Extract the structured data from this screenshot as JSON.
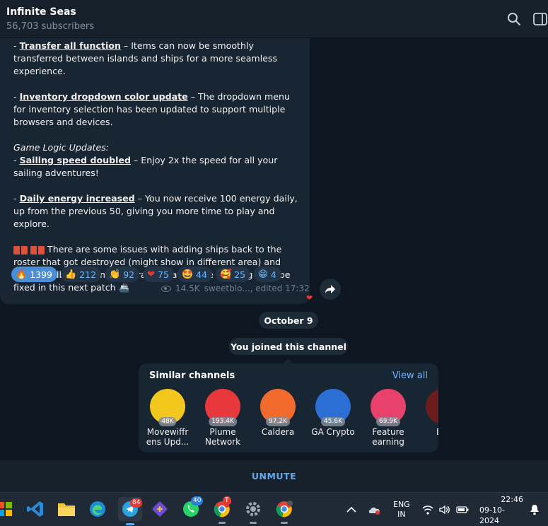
{
  "header": {
    "title": "Infinite Seas",
    "subscribers": "56,703 subscribers",
    "icons": [
      "search-icon",
      "sidebar-toggle-icon"
    ]
  },
  "message": {
    "line1_prefix": "- ",
    "line1_bold": "Transfer all function",
    "line1_rest": " – Items can now be smoothly transferred between islands and ships for a more seamless experience.",
    "line2_prefix": "- ",
    "line2_bold": "Inventory dropdown color update",
    "line2_rest": " – The dropdown menu for inventory selection has been updated to support multiple browsers and devices.",
    "section_title": "Game Logic Updates:",
    "line3_prefix": "- ",
    "line3_bold": "Sailing speed doubled",
    "line3_rest": " – Enjoy 2x the speed for all your sailing adventures!",
    "line4_prefix": "- ",
    "line4_bold": "Daily energy increased",
    "line4_rest": " – You now receive 100 energy daily, up from the previous 50, giving you more time to play and explore.",
    "line5": " There are some issues with adding ships back to the roster that got destroyed (might show in different area) and more feedbacks from our pirates that we are tracking - will be fixed in this next patch ",
    "ship_emoji": "🚢",
    "reactions": [
      {
        "emoji": "🔥",
        "count": "1399",
        "selected": true
      },
      {
        "emoji": "👍",
        "count": "212"
      },
      {
        "emoji": "👏",
        "count": "92"
      },
      {
        "emoji": "❤",
        "count": "75"
      },
      {
        "emoji": "🤩",
        "count": "44"
      },
      {
        "emoji": "🥰",
        "count": "25"
      },
      {
        "emoji": "😁",
        "count": "4"
      }
    ],
    "views": "14.5K",
    "author_edited": "sweetblo..., edited 17:32",
    "heart": "❤"
  },
  "date_pill": "October 9",
  "joined_pill": "You joined this channel",
  "similar": {
    "heading": "Similar channels",
    "view_all": "View all",
    "channels": [
      {
        "name1": "Movewiffr",
        "name2": "ens Upd...",
        "count": "48K",
        "color": "#f2c81f"
      },
      {
        "name1": "Plume",
        "name2": "Network",
        "count": "193.4K",
        "color": "#e8383e"
      },
      {
        "name1": "Caldera",
        "name2": "",
        "count": "97.2K",
        "color": "#f26a2e"
      },
      {
        "name1": "GA Crypto",
        "name2": "",
        "count": "45.6K",
        "color": "#2c6fd4"
      },
      {
        "name1": "Feature",
        "name2": "earning",
        "count": "69.9K",
        "color": "#e8416b"
      },
      {
        "name1": "Eth",
        "name2": "Cr",
        "count": "",
        "color": "#6b1d1d"
      }
    ]
  },
  "unmute": "UNMUTE",
  "taskbar": {
    "telegram_badge": "84",
    "whatsapp_badge": "40",
    "chrome_badge": "T",
    "lang1": "ENG",
    "lang2": "IN",
    "time": "22:46",
    "date": "09-10-2024"
  }
}
